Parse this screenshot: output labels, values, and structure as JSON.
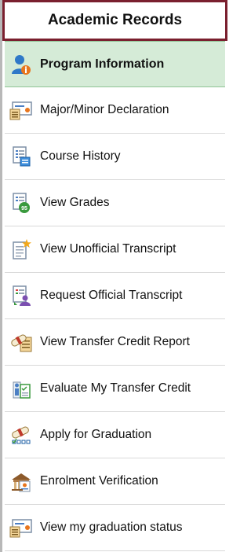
{
  "header": {
    "title": "Academic Records"
  },
  "menu": {
    "items": [
      {
        "label": "Program Information",
        "icon": "user-info-icon",
        "active": true
      },
      {
        "label": "Major/Minor Declaration",
        "icon": "certificate-icon"
      },
      {
        "label": "Course History",
        "icon": "document-list-icon"
      },
      {
        "label": "View Grades",
        "icon": "grades-icon"
      },
      {
        "label": "View Unofficial Transcript",
        "icon": "transcript-star-icon"
      },
      {
        "label": "Request Official Transcript",
        "icon": "request-transcript-icon"
      },
      {
        "label": "View Transfer Credit Report",
        "icon": "diploma-report-icon"
      },
      {
        "label": "Evaluate My Transfer Credit",
        "icon": "evaluate-credit-icon"
      },
      {
        "label": "Apply for Graduation",
        "icon": "diploma-checklist-icon"
      },
      {
        "label": "Enrolment Verification",
        "icon": "enrolment-verification-icon"
      },
      {
        "label": "View my graduation status",
        "icon": "certificate-icon"
      }
    ]
  },
  "colors": {
    "header_border": "#7a1f2e",
    "active_bg": "#d5ebd7"
  }
}
